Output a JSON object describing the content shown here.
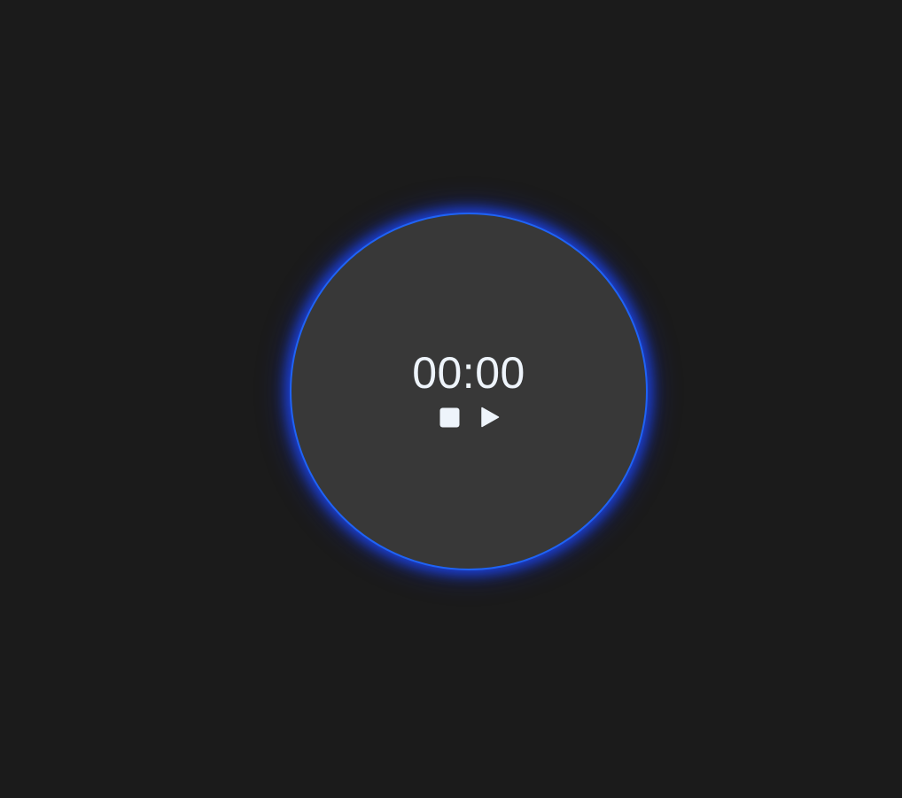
{
  "timer": {
    "time": "00:00",
    "state": "stopped"
  },
  "controls": {
    "stop": {
      "icon": "stop-icon",
      "label": "Stop"
    },
    "play": {
      "icon": "play-icon",
      "label": "Play"
    }
  },
  "colors": {
    "background": "#1b1b1b",
    "dial_fill": "#383838",
    "accent_ring": "#1f63f5",
    "glow": "#1c46f0",
    "text": "#eef4fb"
  }
}
